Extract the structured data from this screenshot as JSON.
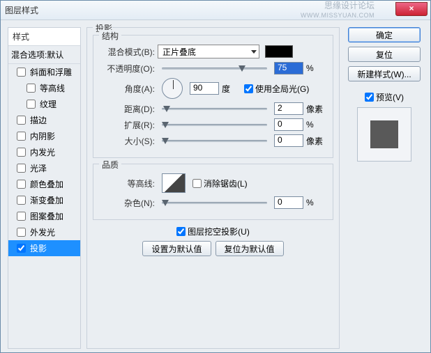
{
  "window": {
    "title": "图层样式"
  },
  "watermark": {
    "line1": "思缘设计论坛",
    "line2": "WWW.MISSYUAN.COM"
  },
  "close": {
    "glyph": "×"
  },
  "styles_panel": {
    "header": "样式",
    "blend_options": "混合选项:默认",
    "items": [
      {
        "label": "斜面和浮雕",
        "checked": false,
        "sub": false
      },
      {
        "label": "等高线",
        "checked": false,
        "sub": true
      },
      {
        "label": "纹理",
        "checked": false,
        "sub": true
      },
      {
        "label": "描边",
        "checked": false,
        "sub": false
      },
      {
        "label": "内阴影",
        "checked": false,
        "sub": false
      },
      {
        "label": "内发光",
        "checked": false,
        "sub": false
      },
      {
        "label": "光泽",
        "checked": false,
        "sub": false
      },
      {
        "label": "颜色叠加",
        "checked": false,
        "sub": false
      },
      {
        "label": "渐变叠加",
        "checked": false,
        "sub": false
      },
      {
        "label": "图案叠加",
        "checked": false,
        "sub": false
      },
      {
        "label": "外发光",
        "checked": false,
        "sub": false
      },
      {
        "label": "投影",
        "checked": true,
        "sub": false,
        "selected": true
      }
    ]
  },
  "main": {
    "title": "投影",
    "structure": {
      "legend": "结构",
      "blend_mode_label": "混合模式(B):",
      "blend_mode_value": "正片叠底",
      "opacity_label": "不透明度(O):",
      "opacity_value": "75",
      "opacity_unit": "%",
      "angle_label": "角度(A):",
      "angle_value": "90",
      "angle_unit": "度",
      "global_light_label": "使用全局光(G)",
      "distance_label": "距离(D):",
      "distance_value": "2",
      "distance_unit": "像素",
      "spread_label": "扩展(R):",
      "spread_value": "0",
      "spread_unit": "%",
      "size_label": "大小(S):",
      "size_value": "0",
      "size_unit": "像素"
    },
    "quality": {
      "legend": "品质",
      "contour_label": "等高线:",
      "antialias_label": "消除锯齿(L)",
      "noise_label": "杂色(N):",
      "noise_value": "0",
      "noise_unit": "%"
    },
    "knockout_label": "图层挖空投影(U)",
    "set_default": "设置为默认值",
    "reset_default": "复位为默认值"
  },
  "buttons": {
    "ok": "确定",
    "cancel": "复位",
    "new_style": "新建样式(W)...",
    "preview": "预览(V)"
  }
}
